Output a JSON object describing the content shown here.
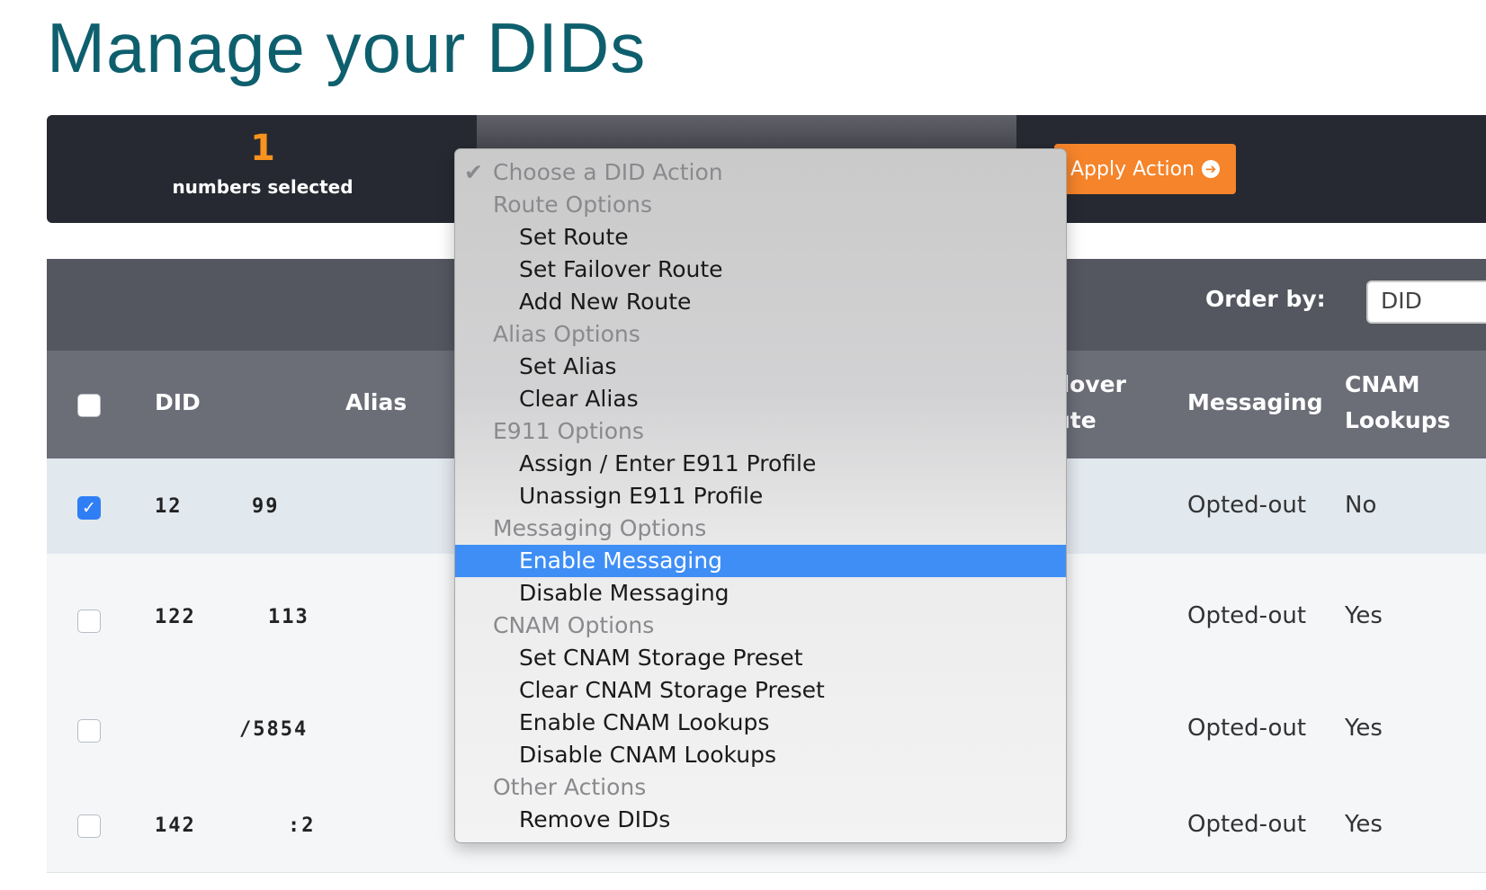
{
  "page_title": "Manage your DIDs",
  "action_bar": {
    "selected_count": "1",
    "selected_label": "numbers selected",
    "apply_button": "Apply Action"
  },
  "dropdown": {
    "check_mark": "✔",
    "options": [
      {
        "label": "Choose a DID Action",
        "kind": "current"
      },
      {
        "label": "Route Options",
        "kind": "group"
      },
      {
        "label": "Set Route",
        "kind": "item"
      },
      {
        "label": "Set Failover Route",
        "kind": "item"
      },
      {
        "label": "Add New Route",
        "kind": "item"
      },
      {
        "label": "Alias Options",
        "kind": "group"
      },
      {
        "label": "Set Alias",
        "kind": "item"
      },
      {
        "label": "Clear Alias",
        "kind": "item"
      },
      {
        "label": "E911 Options",
        "kind": "group"
      },
      {
        "label": "Assign / Enter E911 Profile",
        "kind": "item"
      },
      {
        "label": "Unassign E911 Profile",
        "kind": "item"
      },
      {
        "label": "Messaging Options",
        "kind": "group"
      },
      {
        "label": "Enable Messaging",
        "kind": "item",
        "highlighted": true
      },
      {
        "label": "Disable Messaging",
        "kind": "item"
      },
      {
        "label": "CNAM Options",
        "kind": "group"
      },
      {
        "label": "Set CNAM Storage Preset",
        "kind": "item"
      },
      {
        "label": "Clear CNAM Storage Preset",
        "kind": "item"
      },
      {
        "label": "Enable CNAM Lookups",
        "kind": "item"
      },
      {
        "label": "Disable CNAM Lookups",
        "kind": "item"
      },
      {
        "label": "Other Actions",
        "kind": "group"
      },
      {
        "label": "Remove DIDs",
        "kind": "item"
      }
    ]
  },
  "toolbar": {
    "order_label": "Order by:",
    "order_value": "DID"
  },
  "table": {
    "headers": {
      "did": "DID",
      "alias": "Alias",
      "failover_line1": "ilover",
      "failover_line2": "ute",
      "messaging": "Messaging",
      "cnam_line1": "CNAM",
      "cnam_line2": "Lookups"
    },
    "rows": [
      {
        "did_a": "12",
        "did_b": "99",
        "checked": true,
        "messaging": "Opted-out",
        "cnam": "No"
      },
      {
        "did_a": "122",
        "did_b": "113",
        "checked": false,
        "messaging": "Opted-out",
        "cnam": "Yes"
      },
      {
        "did_a": "",
        "did_b": "/5854",
        "checked": false,
        "messaging": "Opted-out",
        "cnam": "Yes"
      },
      {
        "did_a": "142",
        "did_b": ":2",
        "checked": false,
        "messaging": "Opted-out",
        "cnam": "Yes"
      }
    ]
  },
  "colors": {
    "title": "#0e5f6d",
    "accent_orange": "#f5842a",
    "selection_blue": "#3e8ef5"
  }
}
